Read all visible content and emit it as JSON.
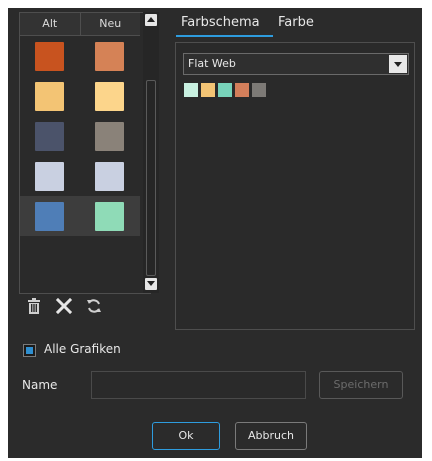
{
  "list": {
    "headers": {
      "old": "Alt",
      "new": "Neu"
    },
    "rows": [
      {
        "old": "#c8531f",
        "new": "#d58256",
        "selected": false
      },
      {
        "old": "#f3c474",
        "new": "#fcd58b",
        "selected": false
      },
      {
        "old": "#4b536a",
        "new": "#8a8279",
        "selected": false
      },
      {
        "old": "#c9d0e1",
        "new": "#c9d0e1",
        "selected": false
      },
      {
        "old": "#4f7eb7",
        "new": "#8fdbb7",
        "selected": true
      }
    ]
  },
  "tabs": {
    "scheme": "Farbschema",
    "color": "Farbe",
    "active": "scheme"
  },
  "scheme_select": {
    "value": "Flat Web"
  },
  "scheme_swatches": [
    "#c8f0e0",
    "#f3c474",
    "#78d3ba",
    "#d37f5b",
    "#7d7a76"
  ],
  "tools": {
    "delete": "trash-icon",
    "remove": "close-icon",
    "reset": "refresh-icon"
  },
  "all_charts": {
    "label": "Alle Grafiken",
    "checked": true
  },
  "name": {
    "label": "Name",
    "value": ""
  },
  "buttons": {
    "save": "Speichern",
    "ok": "Ok",
    "cancel": "Abbruch"
  },
  "colors": {
    "accent": "#2e9cde",
    "background": "#2b2b2b"
  }
}
